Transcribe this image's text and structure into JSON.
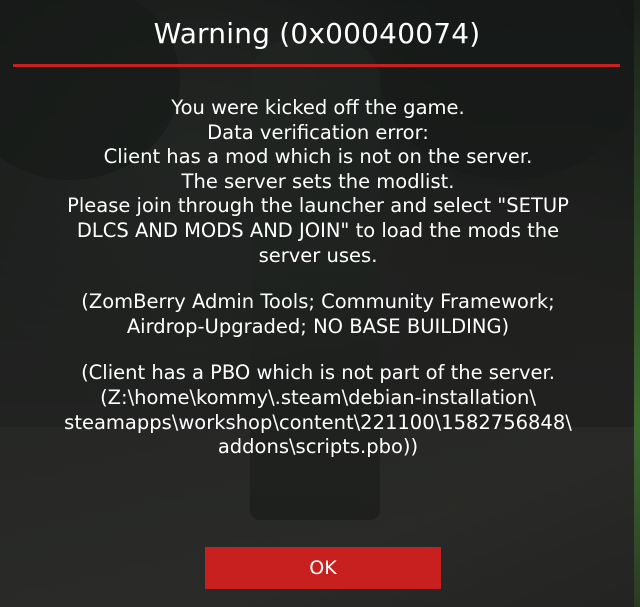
{
  "dialog": {
    "title": "Warning (0x00040074)",
    "accent_color": "#c8201e",
    "message_block_1": [
      "You were kicked off the game.",
      "Data verification error:",
      "Client has a mod which is not on the server.",
      "The server sets the modlist.",
      "Please join through the launcher and select \"SETUP",
      "DLCS AND MODS AND JOIN\" to load the mods the",
      "server uses."
    ],
    "message_block_2": [
      "(ZomBerry Admin Tools; Community Framework;",
      "Airdrop-Upgraded; NO BASE BUILDING)"
    ],
    "message_block_3": [
      "(Client has a PBO which is not part of the server.",
      "(Z:\\home\\kommy\\.steam\\debian-installation\\",
      "steamapps\\workshop\\content\\221100\\1582756848\\",
      "addons\\scripts.pbo))"
    ],
    "ok_label": "OK"
  }
}
